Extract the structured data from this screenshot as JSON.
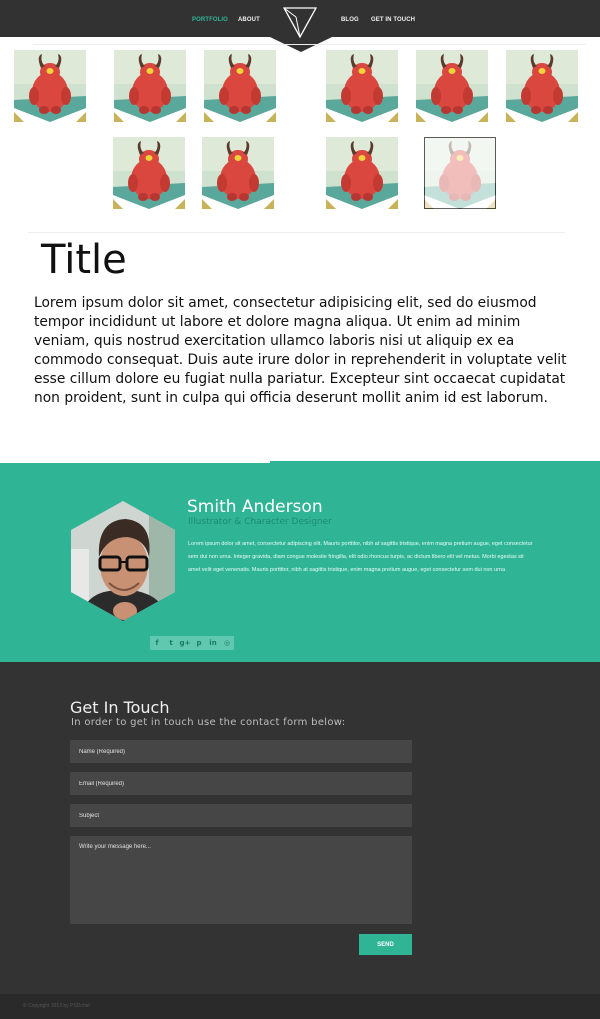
{
  "colors": {
    "accent": "#2fb596",
    "dark": "#333333",
    "header": "#323232"
  },
  "nav": {
    "items": [
      {
        "label": "PORTFOLIO",
        "active": true
      },
      {
        "label": "ABOUT",
        "active": false
      },
      {
        "label": "BLOG",
        "active": false
      },
      {
        "label": "GET IN TOUCH",
        "active": false
      }
    ],
    "logo_icon": "triangle-logo-icon"
  },
  "portfolio": {
    "thumbnail_icon": "red-monster-illustration",
    "selected_index": 9,
    "count": 10
  },
  "article": {
    "title": "Title",
    "body": "Lorem ipsum dolor sit amet, consectetur adipisicing elit, sed do eiusmod tempor incididunt ut labore et dolore magna aliqua. Ut enim ad minim veniam, quis nostrud exercitation ullamco laboris nisi ut aliquip ex ea commodo consequat. Duis aute irure dolor in reprehenderit in voluptate velit esse cillum dolore eu fugiat nulla pariatur. Excepteur sint occaecat cupidatat non proident, sunt in culpa qui officia deserunt mollit anim id est laborum."
  },
  "about": {
    "name": "Smith Anderson",
    "role": "Illustrator & Character Designer",
    "bio": "Lorem ipsum dolor sit amet, consectetur adipiscing elit. Mauris porttitor, nibh at sagittis tristique, enim magna pretium augue, eget consectetur sem dui non urna. Integer gravida, diam congue molestie fringilla, elit odio rhoncus turpis, ac dictum libero elit vel metus. Morbi egestas sit amet velit eget venenatis. Mauris porttitor, nibh at sagittis tristique, enim magna pretium augue, eget consectetur sem dui non urna",
    "social": [
      {
        "icon": "facebook-icon",
        "glyph": "f"
      },
      {
        "icon": "twitter-icon",
        "glyph": "t"
      },
      {
        "icon": "google-plus-icon",
        "glyph": "g+"
      },
      {
        "icon": "pinterest-icon",
        "glyph": "p"
      },
      {
        "icon": "linkedin-icon",
        "glyph": "in"
      },
      {
        "icon": "dribbble-icon",
        "glyph": "◎"
      }
    ]
  },
  "contact": {
    "title": "Get In Touch",
    "subtitle": "In order to get in touch use the contact form below:",
    "name_placeholder": "Name (Required)",
    "email_placeholder": "Email (Required)",
    "subject_placeholder": "Subject",
    "message_placeholder": "Write your message here...",
    "send_label": "SEND"
  },
  "footer": {
    "copyright": "© Copyright 2013 by PSDchef"
  }
}
